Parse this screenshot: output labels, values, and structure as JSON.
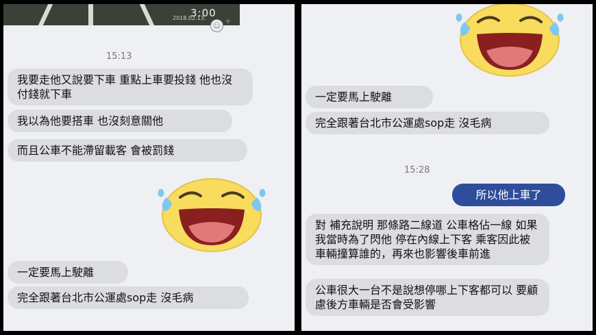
{
  "left": {
    "video_thumb": {
      "timestamp": "2018.02.13.",
      "duration": "3:00"
    },
    "emoji_icon": "smiley-icon",
    "plus_label": "+",
    "time_divider": "15:13",
    "messages": [
      "我要走他又說要下車 重點上車要投錢 他也沒付錢就下車",
      "我以為他要搭車 也沒刻意關他",
      "而且公車不能滯留載客 會被罰錢",
      "一定要馬上駛離",
      "完全跟著台北市公運處sop走 沒毛病"
    ],
    "sticker": "laughing-tears-sticker"
  },
  "right": {
    "sticker": "laughing-tears-sticker",
    "messages_top": [
      "一定要馬上駛離",
      "完全跟著台北市公運處sop走 沒毛病"
    ],
    "time_divider": "15:28",
    "my_message": "所以他上車了",
    "messages_bottom": [
      "對 補充說明 那條路二線道 公車格佔一線 如果我當時為了閃他 停在內線上下客 乘客因此被車輛撞算誰的，再來也影響後車前進",
      "公車很大一台不是說想停哪上下客都可以 要顧慮後方車輛是否會受影響"
    ]
  },
  "colors": {
    "bubble_incoming": "#dcdde1",
    "bubble_outgoing": "#2e4e9c",
    "background": "#eef0f3",
    "frame": "#000000"
  }
}
